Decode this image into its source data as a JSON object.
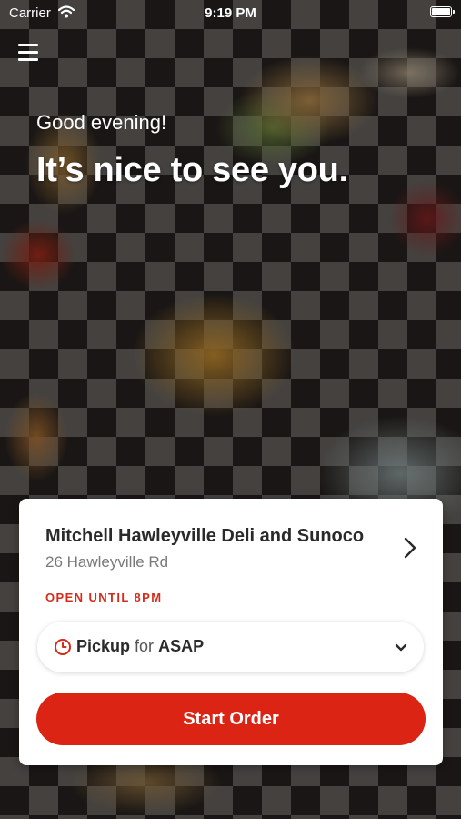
{
  "status_bar": {
    "carrier": "Carrier",
    "time": "9:19 PM"
  },
  "header": {
    "greeting": "Good evening!",
    "headline": "It’s nice to see you."
  },
  "store": {
    "name": "Mitchell Hawleyville Deli and Sunoco",
    "address": "26 Hawleyville Rd",
    "hours": "OPEN UNTIL 8PM"
  },
  "order_mode": {
    "method": "Pickup",
    "connector": "for",
    "time": "ASAP"
  },
  "actions": {
    "start_order": "Start Order"
  },
  "colors": {
    "accent": "#dc2414",
    "hours_text": "#d42b1b"
  },
  "icons": [
    "menu-icon",
    "wifi-icon",
    "battery-icon",
    "chevron-right-icon",
    "clock-icon",
    "chevron-down-icon"
  ]
}
